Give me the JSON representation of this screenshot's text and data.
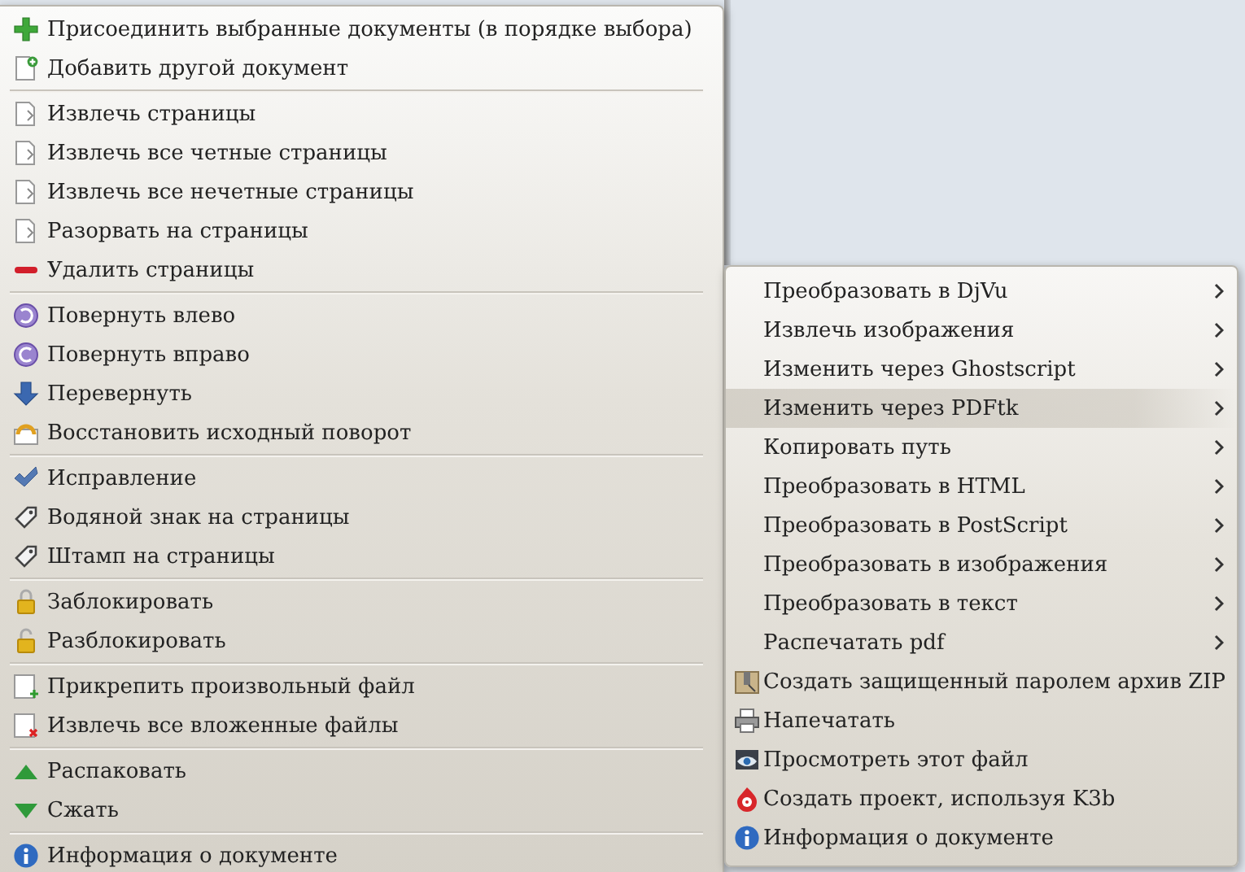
{
  "context_menu": {
    "groups": [
      [
        {
          "label": "Присоединить выбранные документы (в порядке выбора)"
        },
        {
          "label": "Добавить другой документ"
        }
      ],
      [
        {
          "label": "Извлечь страницы"
        },
        {
          "label": "Извлечь все четные страницы"
        },
        {
          "label": "Извлечь все нечетные страницы"
        },
        {
          "label": "Разорвать на страницы"
        },
        {
          "label": "Удалить страницы"
        }
      ],
      [
        {
          "label": "Повернуть влево"
        },
        {
          "label": "Повернуть вправо"
        },
        {
          "label": "Перевернуть"
        },
        {
          "label": "Восстановить исходный поворот"
        }
      ],
      [
        {
          "label": "Исправление"
        },
        {
          "label": "Водяной знак на страницы"
        },
        {
          "label": "Штамп на страницы"
        }
      ],
      [
        {
          "label": "Заблокировать"
        },
        {
          "label": "Разблокировать"
        }
      ],
      [
        {
          "label": "Прикрепить произвольный файл"
        },
        {
          "label": "Извлечь все вложенные файлы"
        }
      ],
      [
        {
          "label": "Распаковать"
        },
        {
          "label": "Сжать"
        }
      ],
      [
        {
          "label": "Информация о документе"
        }
      ]
    ]
  },
  "submenu": {
    "items": [
      {
        "label": "Преобразовать в DjVu",
        "has_submenu": true,
        "selected": false
      },
      {
        "label": "Извлечь изображения",
        "has_submenu": true,
        "selected": false
      },
      {
        "label": "Изменить через Ghostscript",
        "has_submenu": true,
        "selected": false
      },
      {
        "label": "Изменить через PDFtk",
        "has_submenu": true,
        "selected": true
      },
      {
        "label": "Копировать путь",
        "has_submenu": true,
        "selected": false
      },
      {
        "label": "Преобразовать в HTML",
        "has_submenu": true,
        "selected": false
      },
      {
        "label": "Преобразовать в PostScript",
        "has_submenu": true,
        "selected": false
      },
      {
        "label": "Преобразовать в изображения",
        "has_submenu": true,
        "selected": false
      },
      {
        "label": "Преобразовать в текст",
        "has_submenu": true,
        "selected": false
      },
      {
        "label": "Распечатать pdf",
        "has_submenu": true,
        "selected": false
      },
      {
        "label": "Создать защищенный паролем архив ZIP",
        "has_submenu": false,
        "selected": false
      },
      {
        "label": "Напечатать",
        "has_submenu": false,
        "selected": false
      },
      {
        "label": "Просмотреть этот файл",
        "has_submenu": false,
        "selected": false
      },
      {
        "label": "Создать проект, используя K3b",
        "has_submenu": false,
        "selected": false
      },
      {
        "label": "Информация о документе",
        "has_submenu": false,
        "selected": false
      }
    ]
  }
}
